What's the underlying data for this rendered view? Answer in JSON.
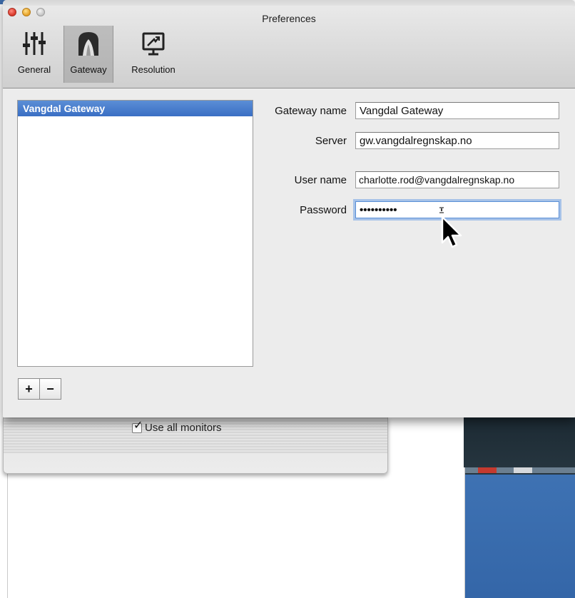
{
  "window": {
    "title": "Preferences"
  },
  "toolbar": {
    "items": [
      {
        "label": "General",
        "icon": "sliders-icon",
        "selected": false
      },
      {
        "label": "Gateway",
        "icon": "gateway-tunnel-icon",
        "selected": true
      },
      {
        "label": "Resolution",
        "icon": "display-presentation-icon",
        "selected": false
      }
    ]
  },
  "gateway_list": {
    "items": [
      {
        "label": "Vangdal Gateway",
        "selected": true
      }
    ],
    "add_label": "+",
    "remove_label": "−"
  },
  "form": {
    "gateway_name": {
      "label": "Gateway name",
      "value": "Vangdal Gateway"
    },
    "server": {
      "label": "Server",
      "value": "gw.vangdalregnskap.no"
    },
    "user_name": {
      "label": "User name",
      "value": "charlotte.rod@vangdalregnskap.no"
    },
    "password": {
      "label": "Password",
      "value": "••••••••••"
    }
  },
  "background": {
    "monitors_checkbox_label": "Use all monitors",
    "monitors_checked": true
  },
  "colors": {
    "selection": "#3a6fc4",
    "focus_ring": "#5a8fd6"
  }
}
